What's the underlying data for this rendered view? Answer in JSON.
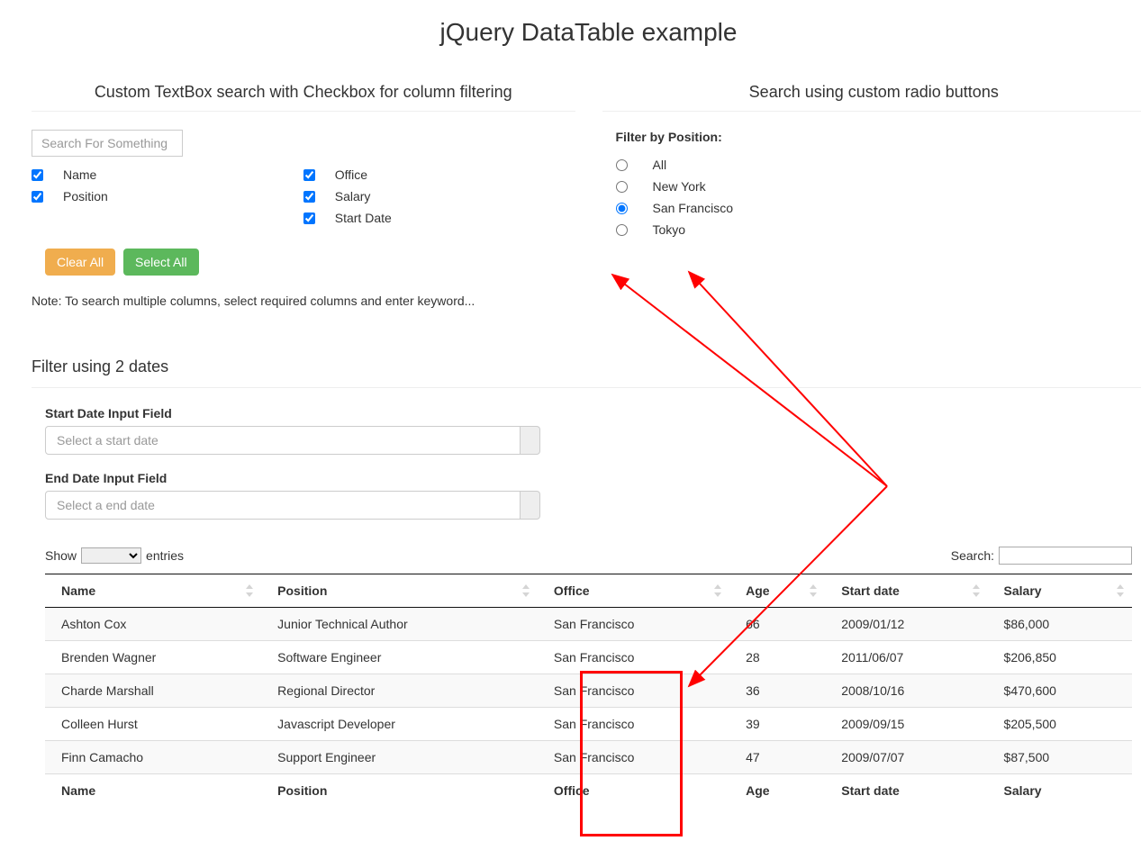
{
  "page_title": "jQuery DataTable example",
  "left_section": {
    "title": "Custom TextBox search with Checkbox for column filtering",
    "search_placeholder": "Search For Something",
    "checkboxes_left": [
      {
        "label": "Name",
        "checked": true
      },
      {
        "label": "Position",
        "checked": true
      }
    ],
    "checkboxes_right": [
      {
        "label": "Office",
        "checked": true
      },
      {
        "label": "Salary",
        "checked": true
      },
      {
        "label": "Start Date",
        "checked": true
      }
    ],
    "clear_btn": "Clear All",
    "select_btn": "Select All",
    "note": "Note: To search multiple columns, select required columns and enter keyword..."
  },
  "right_section": {
    "title": "Search using custom radio buttons",
    "filter_label": "Filter by Position:",
    "radios": [
      {
        "label": "All",
        "checked": false
      },
      {
        "label": "New York",
        "checked": false
      },
      {
        "label": "San Francisco",
        "checked": true
      },
      {
        "label": "Tokyo",
        "checked": false
      }
    ]
  },
  "dates_section": {
    "title": "Filter using 2 dates",
    "start_label": "Start Date Input Field",
    "start_placeholder": "Select a start date",
    "end_label": "End Date Input Field",
    "end_placeholder": "Select a end date"
  },
  "table_controls": {
    "show_prefix": "Show",
    "show_suffix": "entries",
    "search_label": "Search:"
  },
  "table": {
    "headers": [
      "Name",
      "Position",
      "Office",
      "Age",
      "Start date",
      "Salary"
    ],
    "rows": [
      [
        "Ashton Cox",
        "Junior Technical Author",
        "San Francisco",
        "66",
        "2009/01/12",
        "$86,000"
      ],
      [
        "Brenden Wagner",
        "Software Engineer",
        "San Francisco",
        "28",
        "2011/06/07",
        "$206,850"
      ],
      [
        "Charde Marshall",
        "Regional Director",
        "San Francisco",
        "36",
        "2008/10/16",
        "$470,600"
      ],
      [
        "Colleen Hurst",
        "Javascript Developer",
        "San Francisco",
        "39",
        "2009/09/15",
        "$205,500"
      ],
      [
        "Finn Camacho",
        "Support Engineer",
        "San Francisco",
        "47",
        "2009/07/07",
        "$87,500"
      ]
    ],
    "footers": [
      "Name",
      "Position",
      "Office",
      "Age",
      "Start date",
      "Salary"
    ]
  }
}
